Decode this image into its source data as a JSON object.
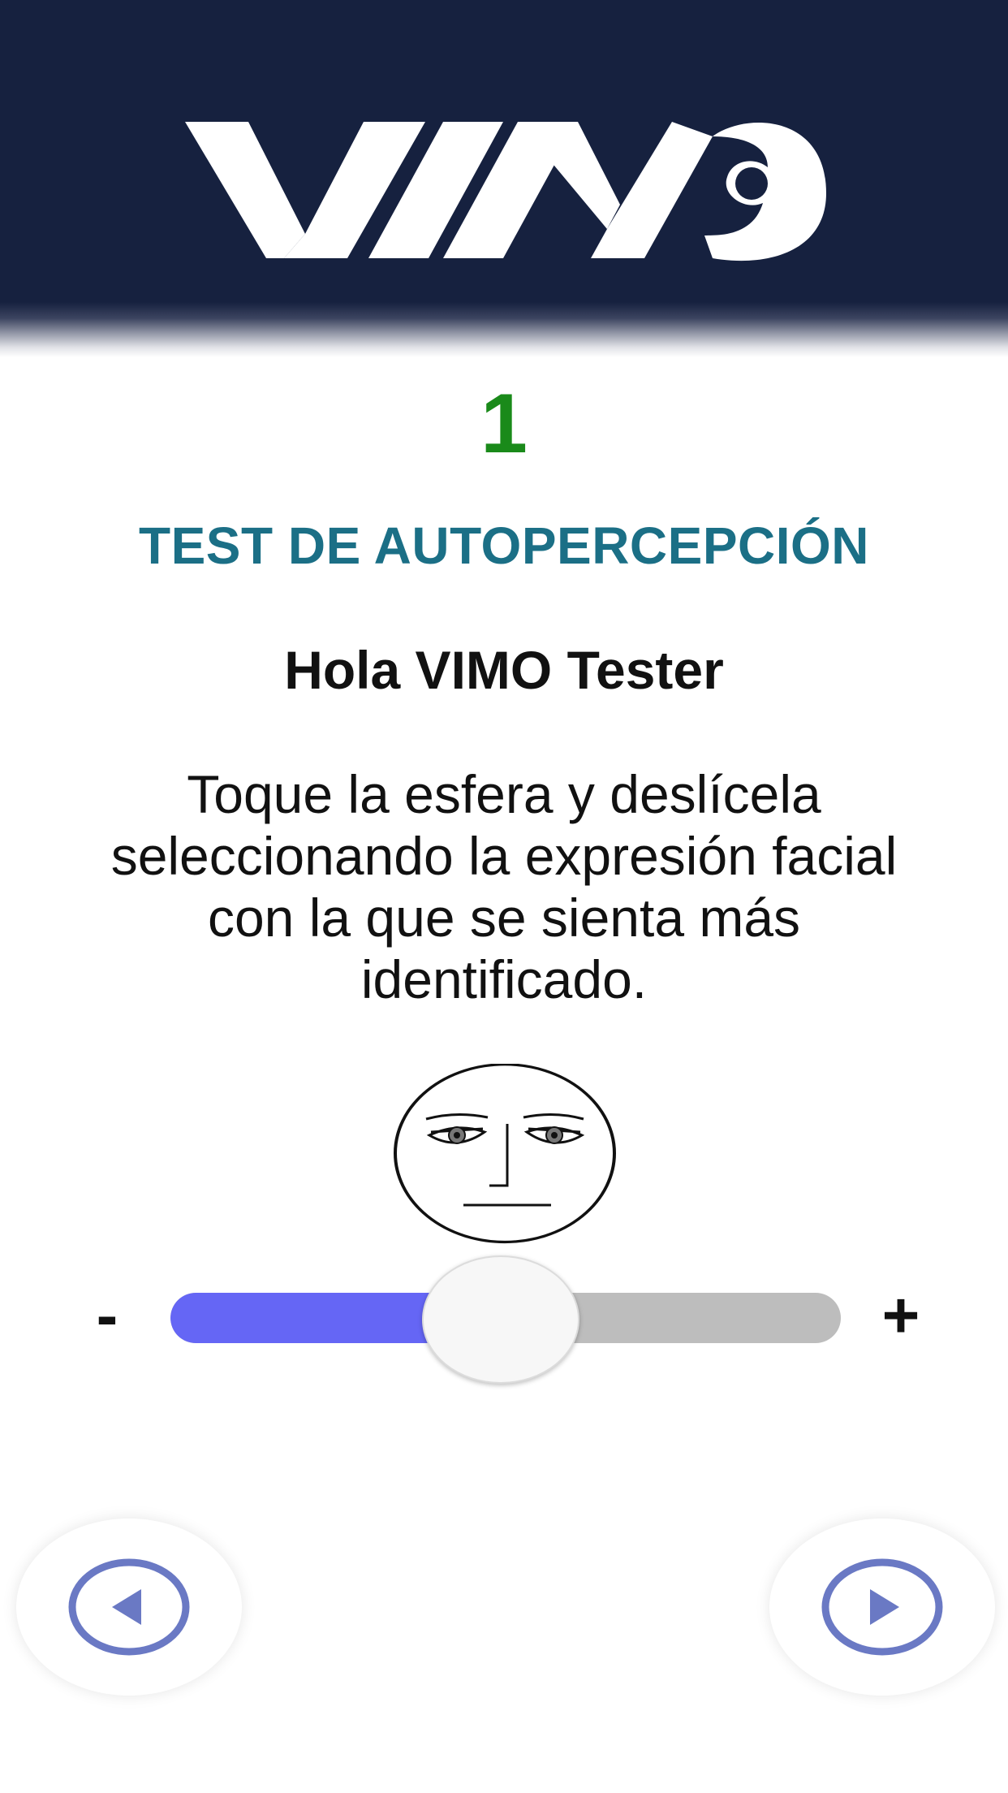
{
  "app": {
    "logo_text": "VIMO"
  },
  "step": {
    "number": "1"
  },
  "test": {
    "title": "TEST DE AUTOPERCEPCIÓN",
    "greeting": "Hola VIMO Tester",
    "instructions": "Toque la esfera y deslícela seleccionando la expresión facial con la que se sienta más identificado."
  },
  "slider": {
    "min_label": "-",
    "max_label": "+",
    "value_fraction": 0.5,
    "fill_color": "#6566f5",
    "track_color": "#bdbdbd"
  },
  "face": {
    "icon": "neutral-face-icon"
  },
  "navigation": {
    "prev_icon": "play-left-icon",
    "next_icon": "play-right-icon",
    "icon_color": "#6a79c4"
  },
  "colors": {
    "header_bg": "#16213f",
    "step_number": "#1a8a1a",
    "title": "#1b6f86"
  }
}
